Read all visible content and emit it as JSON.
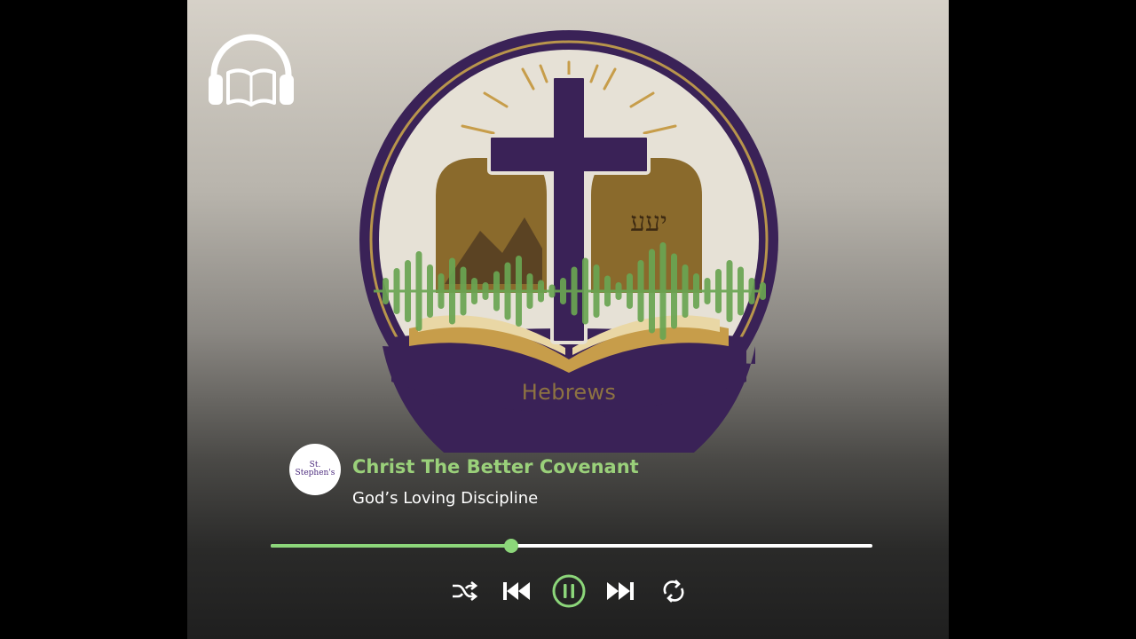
{
  "logo": {
    "title": "Hebrews"
  },
  "channel": {
    "avatar_text": "St. Stephen's"
  },
  "track": {
    "title": "Christ The Better Covenant",
    "subtitle": "God’s Loving Discipline"
  },
  "player": {
    "progress": 0.4,
    "state": "playing",
    "accent_color": "#8cd67a",
    "controls": [
      "shuffle-icon",
      "previous-icon",
      "pause-icon",
      "next-icon",
      "repeat-icon"
    ]
  }
}
